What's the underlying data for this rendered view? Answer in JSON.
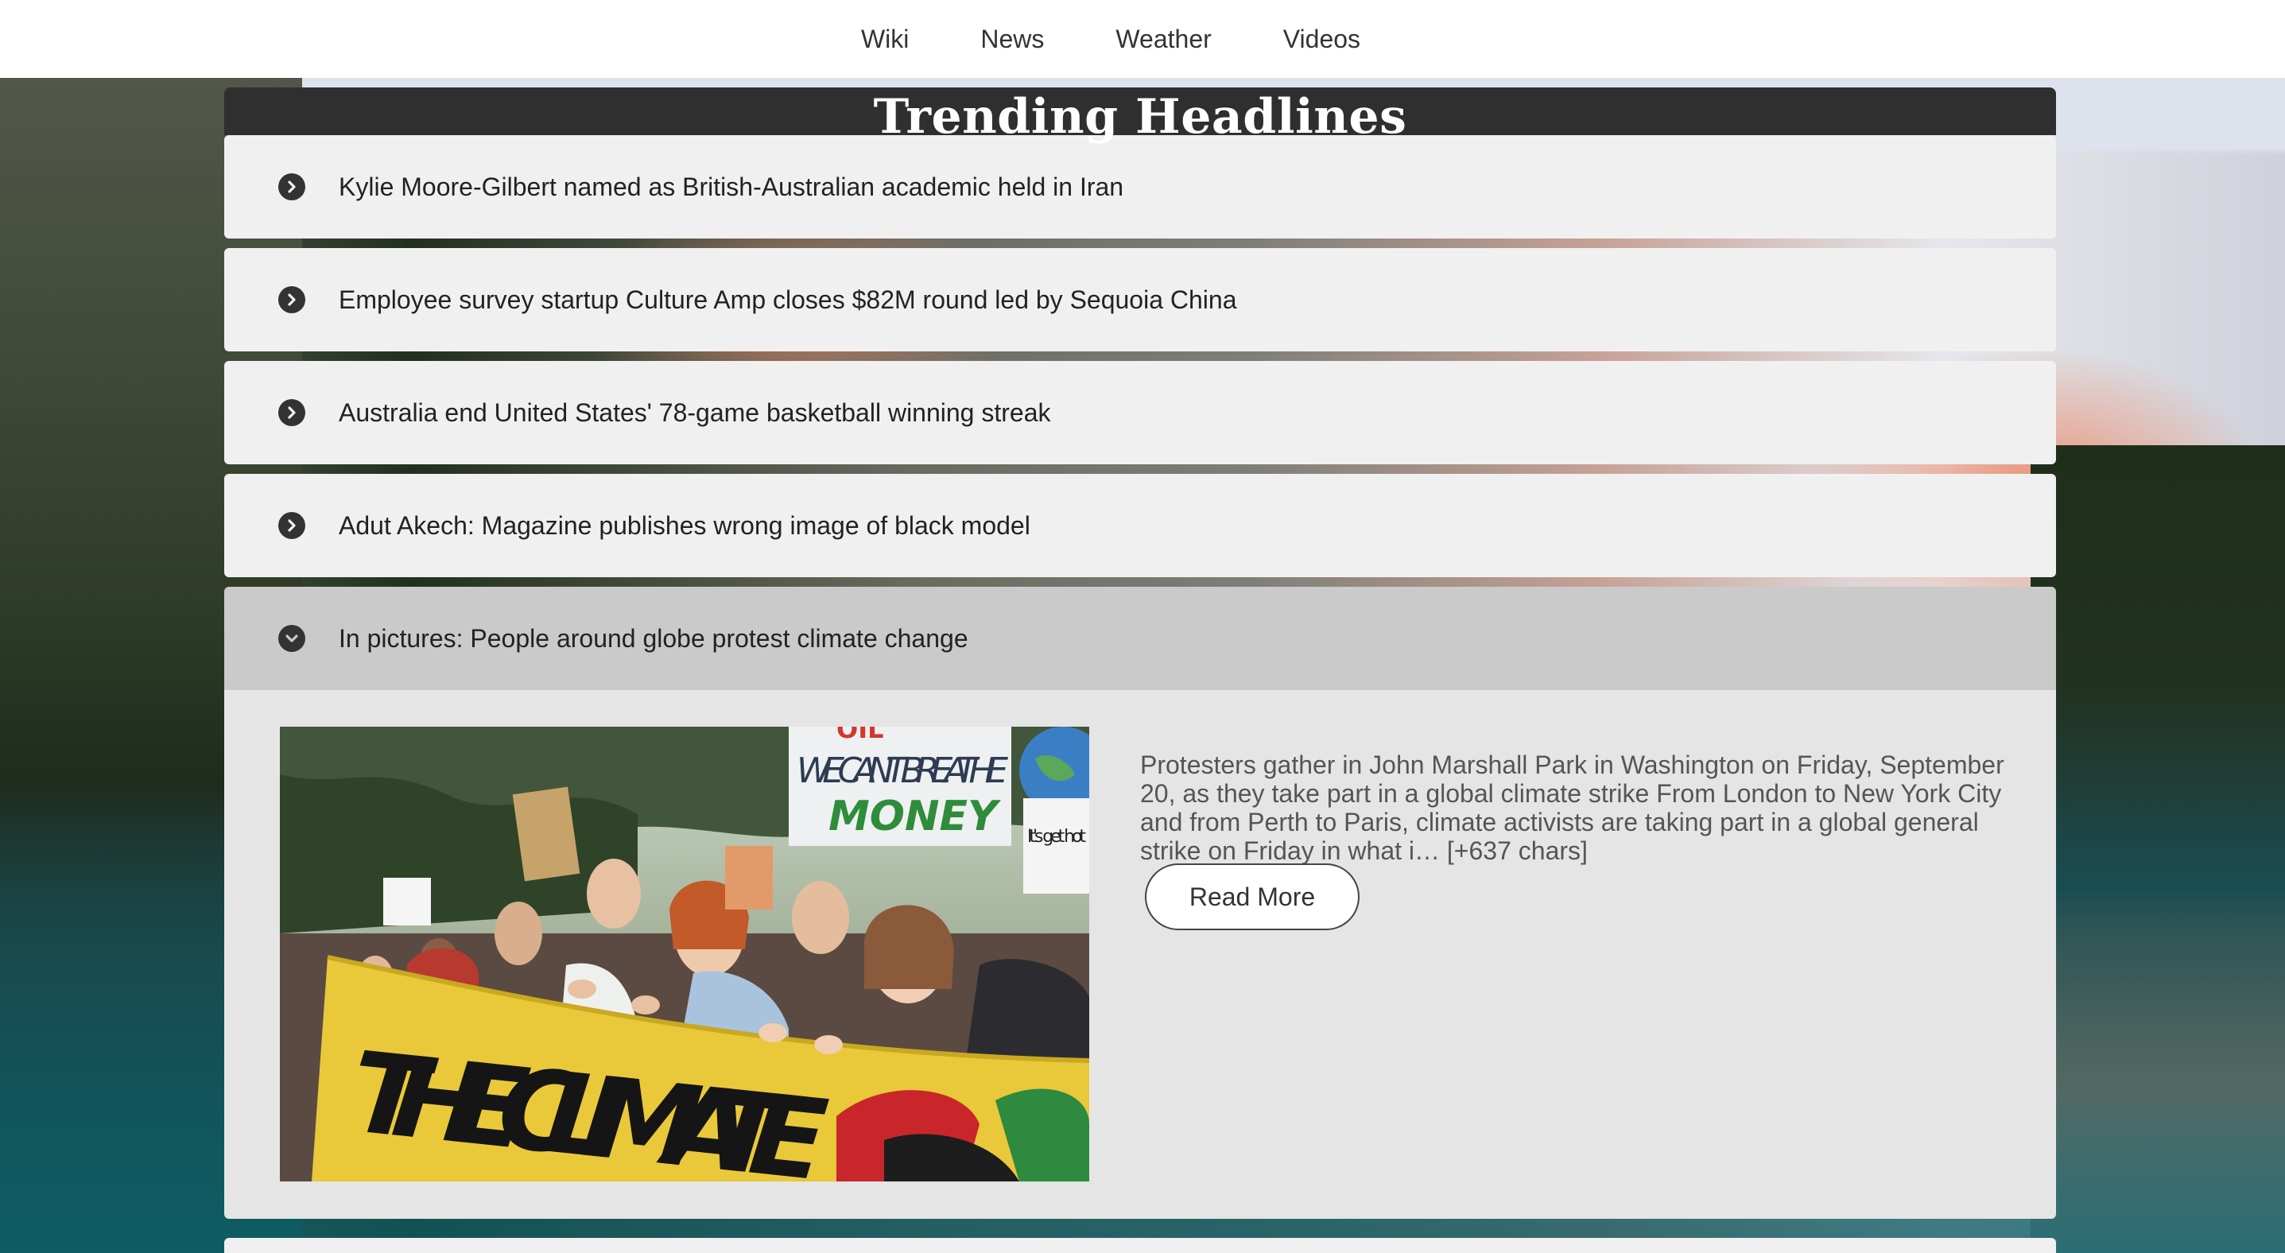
{
  "nav": {
    "items": [
      {
        "label": "Wiki"
      },
      {
        "label": "News"
      },
      {
        "label": "Weather"
      },
      {
        "label": "Videos"
      }
    ]
  },
  "panel": {
    "title": "Trending Headlines",
    "headlines": [
      {
        "text": "Kylie Moore-Gilbert named as British-Australian academic held in Iran",
        "icon": "chevron-right-circle-icon"
      },
      {
        "text": "Employee survey startup Culture Amp closes $82M round led by Sequoia China",
        "icon": "chevron-right-circle-icon"
      },
      {
        "text": "Australia end United States' 78-game basketball winning streak",
        "icon": "chevron-right-circle-icon"
      },
      {
        "text": "Adut Akech: Magazine publishes wrong image of black model",
        "icon": "chevron-right-circle-icon"
      },
      {
        "text": "In pictures: People around globe protest climate change",
        "icon": "chevron-down-circle-icon",
        "expanded": true
      }
    ],
    "expanded": {
      "summary": "Protesters gather in John Marshall Park in Washington on Friday, September 20, as they take part in a global climate strike From London to New York City and from Perth to Paris, climate activists are taking part in a global general strike on Friday in what i… [+637 chars]",
      "read_more_label": "Read More",
      "photo": {
        "sign_top": "OIL",
        "sign_main": "WE CAN'T BREATHE",
        "sign_money": "MONEY",
        "sign_side": "It's get hot",
        "banner": "THE CLIMATE"
      }
    }
  },
  "colors": {
    "nav_bg": "#ffffff",
    "title_bar": "#2f2f2f",
    "item_bg": "#f0f0f0",
    "item_open_bg": "#cacaca",
    "detail_bg": "#e5e5e5"
  }
}
